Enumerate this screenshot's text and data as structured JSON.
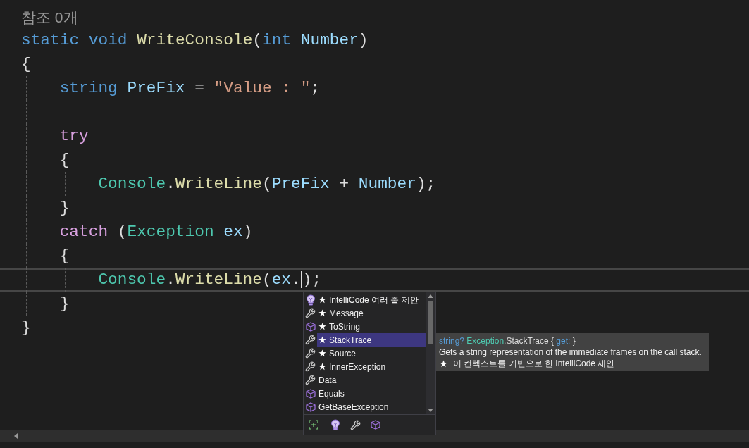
{
  "codelens": "참조 0개",
  "code_lines": [
    {
      "kind": "code",
      "current": false,
      "tokens": [
        {
          "text": "static",
          "kind": "keyword"
        },
        {
          "text": " void",
          "kind": "keyword"
        },
        {
          "text": " WriteConsole",
          "kind": "method"
        },
        {
          "text": "(",
          "kind": "punct"
        },
        {
          "text": "int",
          "kind": "keyword"
        },
        {
          "text": " Number",
          "kind": "param"
        },
        {
          "text": ")",
          "kind": "punct"
        }
      ]
    },
    {
      "kind": "code",
      "current": false,
      "tokens": [
        {
          "text": "{",
          "kind": "punct"
        }
      ],
      "children": [
        {
          "kind": "code",
          "current": false,
          "tokens": [
            {
              "text": "string",
              "kind": "keyword"
            },
            {
              "text": " PreFix",
              "kind": "param"
            },
            {
              "text": " =",
              "kind": "punct"
            },
            {
              "text": " \"Value : \"",
              "kind": "string"
            },
            {
              "text": ";",
              "kind": "punct"
            }
          ]
        },
        {
          "kind": "blank"
        },
        {
          "kind": "code",
          "current": false,
          "tokens": [
            {
              "text": "try",
              "kind": "control"
            }
          ]
        },
        {
          "kind": "code",
          "current": false,
          "tokens": [
            {
              "text": "{",
              "kind": "punct"
            }
          ],
          "children": [
            {
              "kind": "code",
              "current": false,
              "tokens": [
                {
                  "text": "Console",
                  "kind": "type"
                },
                {
                  "text": ".",
                  "kind": "punct"
                },
                {
                  "text": "WriteLine",
                  "kind": "method"
                },
                {
                  "text": "(",
                  "kind": "punct"
                },
                {
                  "text": "PreFix",
                  "kind": "param"
                },
                {
                  "text": " +",
                  "kind": "punct"
                },
                {
                  "text": " Number",
                  "kind": "param"
                },
                {
                  "text": ");",
                  "kind": "punct"
                }
              ]
            }
          ]
        },
        {
          "kind": "code",
          "current": false,
          "tokens": [
            {
              "text": "}",
              "kind": "punct"
            }
          ]
        },
        {
          "kind": "code",
          "current": false,
          "tokens": [
            {
              "text": "catch",
              "kind": "control"
            },
            {
              "text": " (",
              "kind": "punct"
            },
            {
              "text": "Exception",
              "kind": "type"
            },
            {
              "text": " ex",
              "kind": "param"
            },
            {
              "text": ")",
              "kind": "punct"
            }
          ]
        },
        {
          "kind": "code",
          "current": false,
          "tokens": [
            {
              "text": "{",
              "kind": "punct"
            }
          ],
          "children": [
            {
              "kind": "code",
              "current": true,
              "tokens": [
                {
                  "text": "Console",
                  "kind": "type"
                },
                {
                  "text": ".",
                  "kind": "punct"
                },
                {
                  "text": "WriteLine",
                  "kind": "method"
                },
                {
                  "text": "(",
                  "kind": "punct"
                },
                {
                  "text": "ex",
                  "kind": "param"
                },
                {
                  "text": ".",
                  "kind": "punct",
                  "caret": true
                },
                {
                  "text": ");",
                  "kind": "punct"
                }
              ]
            }
          ]
        },
        {
          "kind": "code",
          "current": false,
          "tokens": [
            {
              "text": "}",
              "kind": "punct"
            }
          ]
        }
      ]
    },
    {
      "kind": "code",
      "current": false,
      "tokens": [
        {
          "text": "}",
          "kind": "punct"
        }
      ]
    }
  ],
  "completion": {
    "items": [
      {
        "label": "IntelliCode 여러 줄 제안",
        "kind": "intellicode",
        "starred": true,
        "selected": false
      },
      {
        "label": "Message",
        "kind": "property",
        "starred": true,
        "selected": false
      },
      {
        "label": "ToString",
        "kind": "method",
        "starred": true,
        "selected": false
      },
      {
        "label": "StackTrace",
        "kind": "property",
        "starred": true,
        "selected": true
      },
      {
        "label": "Source",
        "kind": "property",
        "starred": true,
        "selected": false
      },
      {
        "label": "InnerException",
        "kind": "property",
        "starred": true,
        "selected": false
      },
      {
        "label": "Data",
        "kind": "property",
        "starred": false,
        "selected": false
      },
      {
        "label": "Equals",
        "kind": "method",
        "starred": false,
        "selected": false
      },
      {
        "label": "GetBaseException",
        "kind": "method",
        "starred": false,
        "selected": false
      }
    ],
    "filters": [
      {
        "kind": "intellicode"
      },
      {
        "kind": "property"
      },
      {
        "kind": "method"
      }
    ]
  },
  "tooltip": {
    "signature": [
      {
        "text": "string?",
        "kind": "keyword"
      },
      {
        "text": " Exception",
        "kind": "type"
      },
      {
        "text": ".StackTrace { ",
        "kind": "plain"
      },
      {
        "text": "get;",
        "kind": "keyword"
      },
      {
        "text": " }",
        "kind": "plain"
      }
    ],
    "description": "Gets a string representation of the immediate frames on the call stack.",
    "note": "이 컨텍스트를 기반으로 한 IntelliCode 제안"
  }
}
